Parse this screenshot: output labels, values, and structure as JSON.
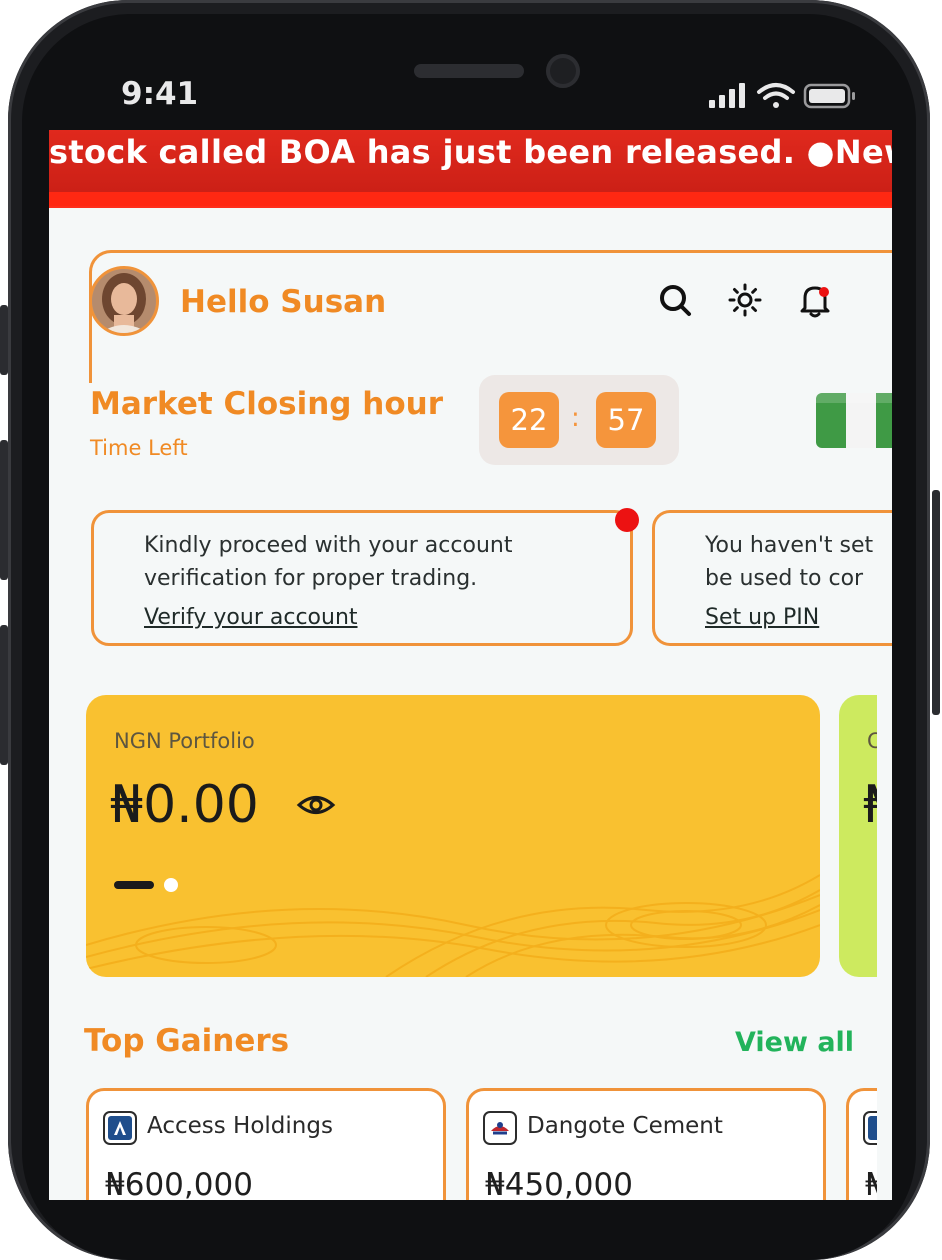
{
  "status_bar": {
    "time": "9:41"
  },
  "ticker": {
    "text": "stock called BOA has just been released.  ●New"
  },
  "header": {
    "greeting": "Hello Susan",
    "icons": [
      "search-icon",
      "sun-icon",
      "bell-icon"
    ]
  },
  "market": {
    "title": "Market Closing hour",
    "subtitle": "Time Left",
    "hours": "22",
    "separator": ":",
    "minutes": "57"
  },
  "notices": [
    {
      "text": "Kindly proceed with your account verification for proper trading.",
      "link": "Verify your account"
    },
    {
      "text": "You haven't se be used to cor",
      "line1": "You haven't set",
      "line2": "be used to cor",
      "link": "Set up PIN"
    }
  ],
  "portfolio": {
    "label": "NGN Portfolio",
    "amount": "₦0.00",
    "second_card_label": "C",
    "second_card_amount": "₦"
  },
  "top_gainers": {
    "title": "Top Gainers",
    "view_all": "View all",
    "stocks": [
      {
        "name": "Access Holdings",
        "price": "₦600,000"
      },
      {
        "name": "Dangote Cement",
        "price": "₦450,000"
      },
      {
        "name": "",
        "price": "₦"
      }
    ]
  },
  "colors": {
    "accent": "#f08a24",
    "ticker_red": "#d9241a",
    "portfolio_yellow": "#f9c130",
    "view_all_green": "#22b35b"
  }
}
